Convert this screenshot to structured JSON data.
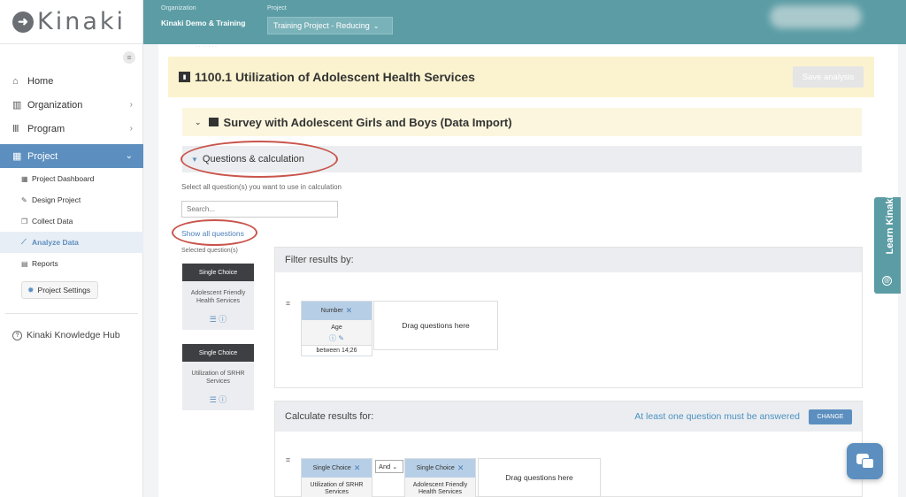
{
  "app": {
    "logo_text": "Kinaki"
  },
  "topbar": {
    "org_label": "Organization",
    "org_value": "Kinaki Demo & Training",
    "project_label": "Project",
    "project_value": "Training Project - Reducing"
  },
  "sidebar": {
    "items": [
      {
        "label": "Home",
        "icon": "home-icon"
      },
      {
        "label": "Organization",
        "icon": "building-icon"
      },
      {
        "label": "Program",
        "icon": "bars-icon"
      },
      {
        "label": "Project",
        "icon": "grid-icon"
      }
    ],
    "sub_items": [
      {
        "label": "Project Dashboard",
        "icon": "dashboard-icon"
      },
      {
        "label": "Design Project",
        "icon": "pencil-icon"
      },
      {
        "label": "Collect Data",
        "icon": "copy-icon"
      },
      {
        "label": "Analyze Data",
        "icon": "chart-icon"
      },
      {
        "label": "Reports",
        "icon": "file-icon"
      }
    ],
    "settings_label": "Project Settings",
    "hub_label": "Kinaki Knowledge Hub"
  },
  "main": {
    "analysis_title": "1100.1 Utilization of Adolescent Health Services",
    "save_label": "Save analysis",
    "survey_title": "Survey with Adolescent Girls and Boys (Data Import)",
    "qc_label": "Questions & calculation",
    "select_hint": "Select all question(s) you want to use in calculation",
    "search_placeholder": "Search...",
    "show_all": "Show all questions",
    "selected_label": "Selected question(s)",
    "questions": [
      {
        "type": "Single Choice",
        "name": "Adolescent Friendly Health Services"
      },
      {
        "type": "Single Choice",
        "name": "Utilization of SRHR Services"
      }
    ],
    "filter": {
      "title": "Filter results by:",
      "chip_type": "Number",
      "chip_name": "Age",
      "chip_range": "between 14;26",
      "drop_label": "Drag questions here"
    },
    "calc": {
      "title": "Calculate results for:",
      "warning": "At least one question must be answered",
      "change_label": "CHANGE",
      "operator": "And",
      "chips": [
        {
          "type": "Single Choice",
          "name": "Utilization of SRHR Services"
        },
        {
          "type": "Single Choice",
          "name": "Adolescent Friendly Health Services"
        }
      ],
      "drop_label": "Drag questions here"
    }
  },
  "learn_tab": {
    "label": "Learn Kinaki"
  },
  "colors": {
    "accent": "#5c8fbf",
    "topbar": "#5c9da5",
    "highlight": "#c9544b"
  }
}
